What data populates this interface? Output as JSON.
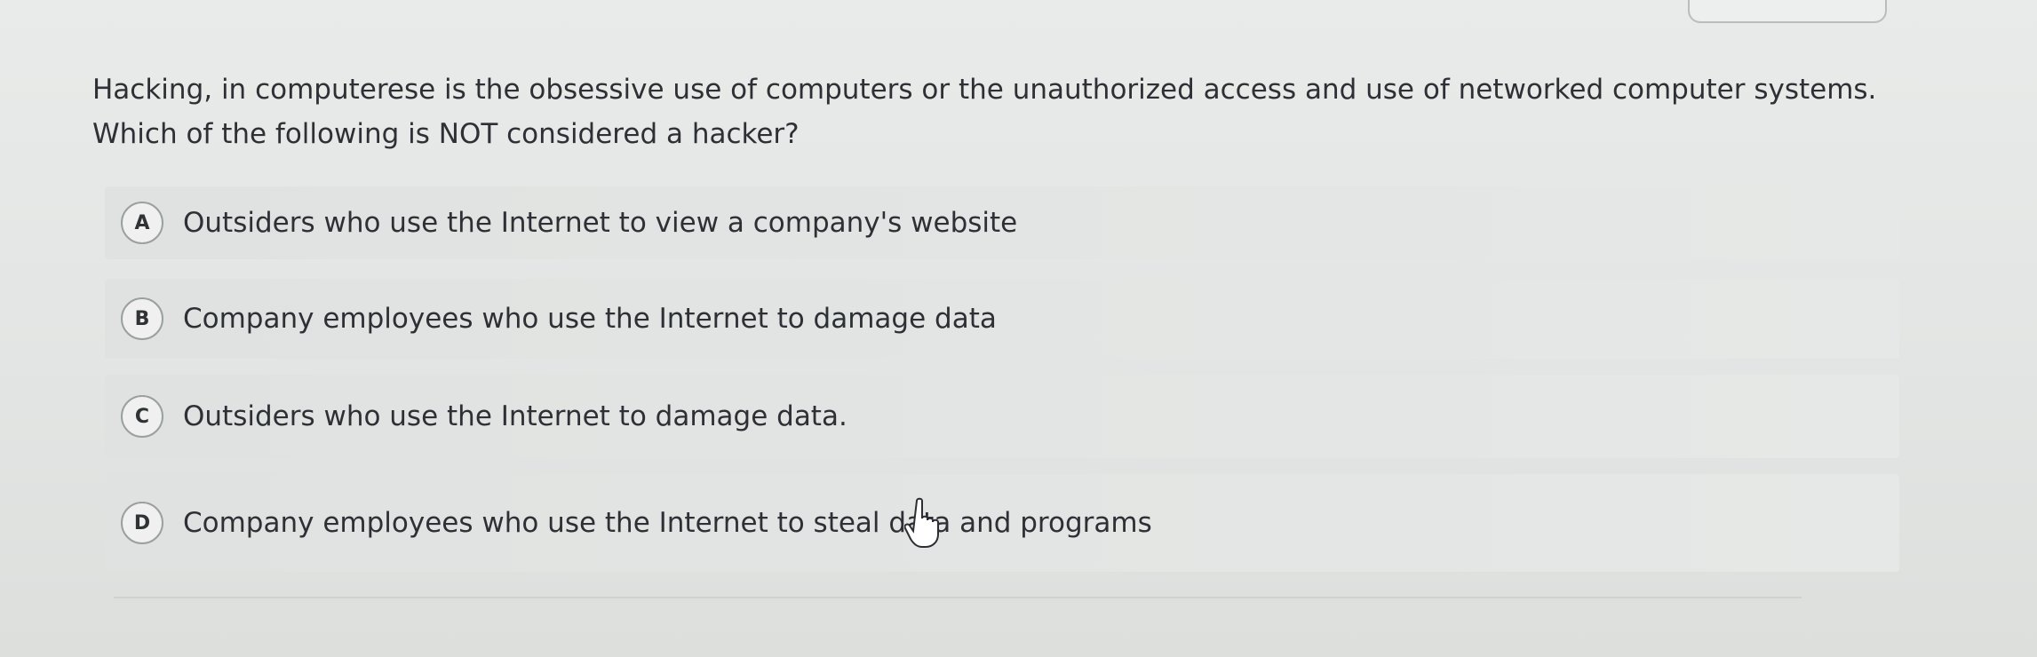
{
  "question": {
    "line1": "Hacking, in computerese is the obsessive use of computers or the unauthorized access and use of networked computer systems.",
    "line2": "Which of the following is NOT considered a hacker?"
  },
  "options": [
    {
      "letter": "A",
      "label": "Outsiders who use the Internet to view a company's website"
    },
    {
      "letter": "B",
      "label": "Company employees who use the Internet to damage data"
    },
    {
      "letter": "C",
      "label": "Outsiders who use the Internet to damage data."
    },
    {
      "letter": "D",
      "label": "Company employees who use the Internet to steal data and programs"
    }
  ],
  "icons": {
    "cursor": "hand-pointer-icon"
  }
}
